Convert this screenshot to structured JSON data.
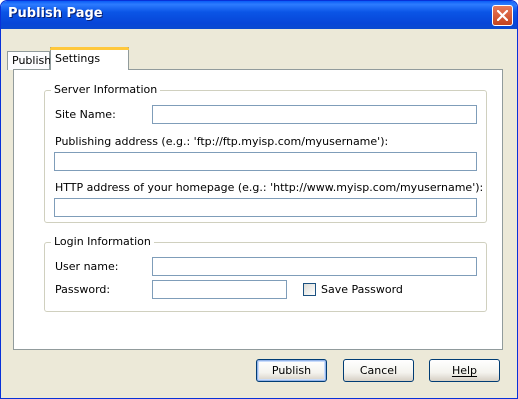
{
  "window": {
    "title": "Publish Page"
  },
  "tabs": [
    {
      "label": "Publish"
    },
    {
      "label": "Settings"
    }
  ],
  "server_info": {
    "legend": "Server Information",
    "site_name_label": "Site Name:",
    "site_name_value": "",
    "publishing_address_label": "Publishing address (e.g.: 'ftp://ftp.myisp.com/myusername'):",
    "publishing_address_value": "",
    "http_address_label": "HTTP address of your homepage (e.g.: 'http://www.myisp.com/myusername'):",
    "http_address_value": ""
  },
  "login_info": {
    "legend": "Login Information",
    "username_label": "User name:",
    "username_value": "",
    "password_label": "Password:",
    "password_value": "",
    "save_password_label": "Save Password",
    "save_password_checked": false
  },
  "buttons": {
    "publish_label": "Publish",
    "cancel_label": "Cancel",
    "help_label": "Help"
  },
  "icons": {
    "close": "close-icon"
  },
  "colors": {
    "titlebar": "#0a55e6",
    "close": "#c4431e",
    "dialog_bg": "#ece9d8"
  }
}
